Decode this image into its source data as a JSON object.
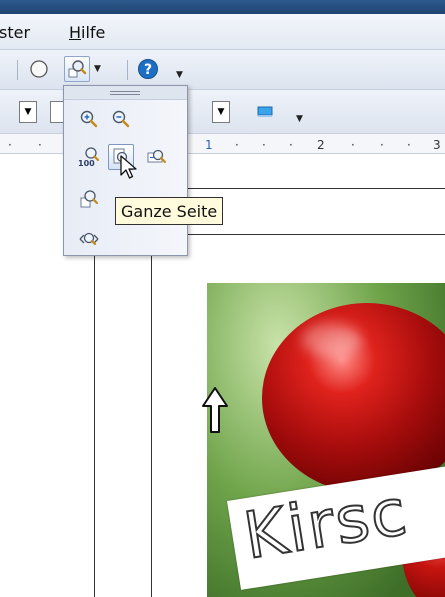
{
  "menubar": {
    "items": [
      {
        "label": "ster",
        "accel": ""
      },
      {
        "label": "ilfe",
        "accel": "H"
      }
    ]
  },
  "ruler": {
    "labels": [
      "1",
      "2",
      "3"
    ]
  },
  "zoom_popup": {
    "tooltip": "Ganze Seite",
    "buttons": [
      {
        "name": "zoom-in",
        "icon": "zoom-in-icon"
      },
      {
        "name": "zoom-out",
        "icon": "zoom-out-icon"
      },
      {
        "name": "zoom-100",
        "icon": "zoom-100-icon",
        "text": "100"
      },
      {
        "name": "entire-page",
        "icon": "entire-page-icon"
      },
      {
        "name": "page-width",
        "icon": "page-width-icon"
      },
      {
        "name": "optimal-view",
        "icon": "optimal-view-icon"
      },
      {
        "name": "object-zoom",
        "icon": "object-zoom-icon"
      }
    ]
  },
  "document": {
    "banner_text": "Kirsc"
  },
  "colors": {
    "accent": "#2d5a8e",
    "help_blue": "#1e6fc4",
    "tooltip_bg": "#fffbdc"
  }
}
